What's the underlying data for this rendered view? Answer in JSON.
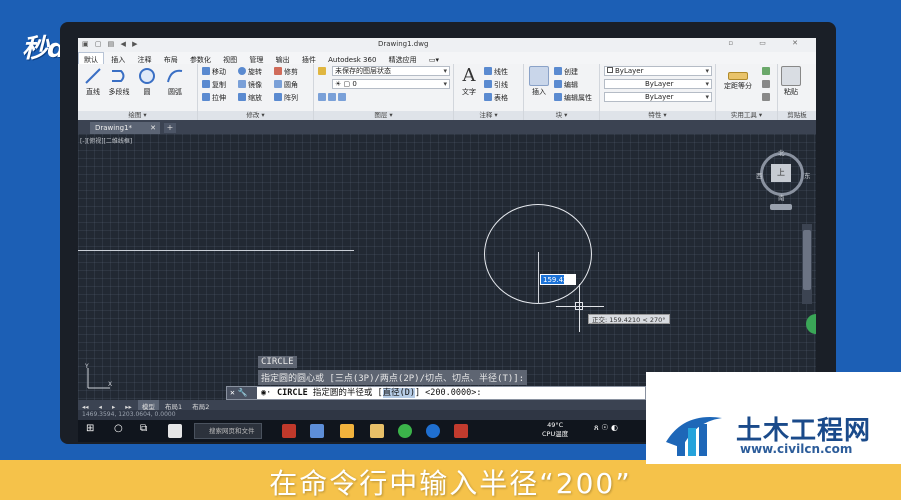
{
  "frame": {
    "brand": "秒dóng视频",
    "caption": "在命令行中输入半径“200”",
    "watermark_title": "土木工程网",
    "watermark_url": "www.civilcn.com"
  },
  "window": {
    "document_title": "Drawing1.dwg",
    "controls": "▫ ▭ ✕"
  },
  "menu": [
    "默认",
    "插入",
    "注释",
    "布局",
    "参数化",
    "视图",
    "管理",
    "输出",
    "插件",
    "Autodesk 360",
    "精选应用",
    "▭▾"
  ],
  "ribbon": {
    "draw": {
      "title": "绘图 ▾",
      "line": "直线",
      "polyline": "多段线",
      "circle": "圆",
      "arc": "圆弧"
    },
    "modify": {
      "title": "修改 ▾",
      "move": "移动",
      "rotate": "旋转",
      "trim": "修剪",
      "copy": "复制",
      "mirror": "镜像",
      "fillet": "圆角",
      "stretch": "拉伸",
      "scale": "缩放",
      "array": "阵列"
    },
    "layer": {
      "title": "图层 ▾",
      "state": "未保存的图层状态",
      "current": "0"
    },
    "annotation": {
      "title": "注释 ▾",
      "text": "文字",
      "linear": "线性",
      "leader": "引线",
      "table": "表格"
    },
    "block": {
      "title": "块 ▾",
      "insert": "插入",
      "create": "创建",
      "edit": "编辑",
      "edit_attr": "编辑属性"
    },
    "properties": {
      "title": "特性 ▾",
      "color": "ByLayer",
      "linetype": "ByLayer",
      "lineweight": "ByLayer"
    },
    "utilities": {
      "title": "实用工具 ▾",
      "measure": "定距等分"
    },
    "clipboard": {
      "title": "剪贴板",
      "paste": "粘贴"
    }
  },
  "file_tab": {
    "name": "Drawing1*",
    "close": "✕"
  },
  "canvas": {
    "view_label": "[-][俯视][二维线框]",
    "dynamic_input": "159.421",
    "polar_tooltip": "正交: 159.4210 < 270°",
    "viewcube": {
      "top": "上",
      "north": "北",
      "south": "南",
      "east": "东",
      "west": "西"
    }
  },
  "command": {
    "history": [
      "CIRCLE",
      "指定圆的圆心或 [三点(3P)/两点(2P)/切点、切点、半径(T)]:"
    ],
    "prompt_cmd": "CIRCLE",
    "prompt_text": " 指定圆的半径或 [",
    "prompt_option": "直径(D)",
    "prompt_default": "] <200.0000>:"
  },
  "layout_tabs": [
    "◂◂",
    "◂",
    "▸",
    "▸▸",
    "模型",
    "布局1",
    "布局2"
  ],
  "status_bar": "1469.3594, 1203.0604, 0.0000",
  "taskbar": {
    "search": "搜索网页和文件",
    "temp": "49°C",
    "temp_label": "CPU温度"
  },
  "colors": {
    "background": "#1c5fb5",
    "canvas": "#222933",
    "band": "#f5c24a",
    "dynamic_input": "#1c73d8"
  }
}
